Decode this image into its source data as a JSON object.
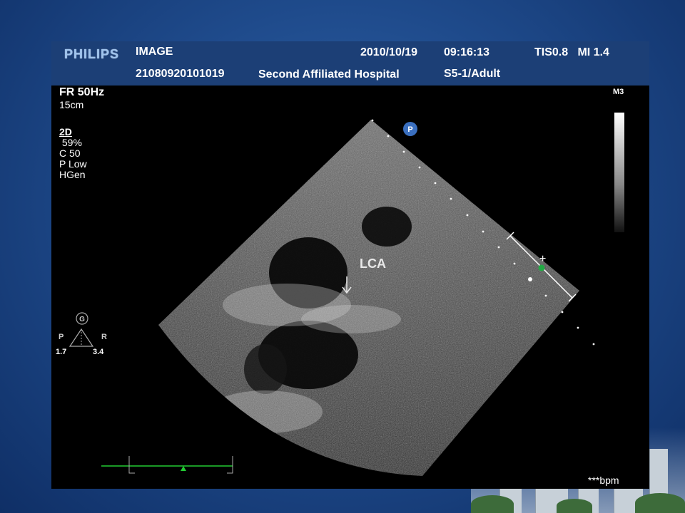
{
  "header": {
    "brand": "PHILIPS",
    "image_label": "IMAGE",
    "date": "2010/10/19",
    "time": "09:16:13",
    "tis_mi": "TIS0.8   MI 1.4",
    "patient_id": "21080920101019",
    "hospital": "Second Affiliated Hospital",
    "probe_preset": "S5-1/Adult"
  },
  "params": {
    "frame_rate": "FR 50Hz",
    "depth": "15cm",
    "mode": "2D",
    "gain": " 59%",
    "compress": "C 50",
    "power": "P Low",
    "freq": "HGen"
  },
  "map_label": "M3",
  "annotation": "LCA",
  "marker_p": "P",
  "orientation": {
    "g": "G",
    "p": "P",
    "r": "R",
    "left_val": "1.7",
    "right_val": "3.4"
  },
  "heart_rate": "***bpm",
  "colors": {
    "header_bg": "#1c3f76",
    "marker_blue": "#3a6fbf",
    "ecg_green": "#22cc33",
    "cursor_green": "#22aa44"
  }
}
